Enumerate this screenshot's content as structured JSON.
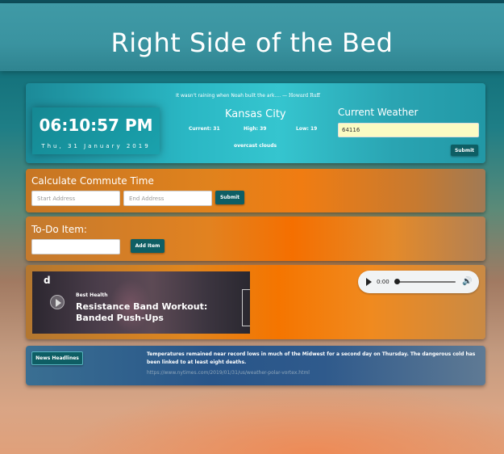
{
  "header": {
    "title": "Right Side of the Bed"
  },
  "weather": {
    "time": "06:10:57 PM",
    "date": "Thu, 31 January 2019",
    "quote_text": "It wasn't raining when Noah built the ark.... —",
    "quote_author": "Howard Ruff",
    "city": "Kansas City",
    "current_label": "Current: 31",
    "high_label": "High: 39",
    "low_label": "Low: 19",
    "description": "overcast clouds",
    "section_title": "Current Weather",
    "zip_value": "64116",
    "submit_label": "Submit"
  },
  "commute": {
    "title": "Calculate Commute Time",
    "start_placeholder": "Start Address",
    "end_placeholder": "End Address",
    "submit_label": "Submit"
  },
  "todo": {
    "title": "To-Do Item:",
    "input_value": "",
    "add_label": "Add Item"
  },
  "media": {
    "video_logo": "d",
    "video_channel": "Best Health",
    "video_title": "Resistance Band Workout: Banded Push-Ups",
    "audio_time": "0:00",
    "audio_progress": 0
  },
  "news": {
    "label": "News Headlines",
    "headline": "Temperatures remained near record lows in much of the Midwest for a second day on Thursday. The dangerous cold has been linked to at least eight deaths.",
    "link": "https://www.nytimes.com/2019/01/31/us/weather-polar-vortex.html"
  },
  "colors": {
    "accent_button": "#0e5e64",
    "header": "#3a93a0",
    "zip_input_bg": "#fbfbc3"
  },
  "icons": {
    "play": "play-icon",
    "volume": "volume-icon"
  }
}
